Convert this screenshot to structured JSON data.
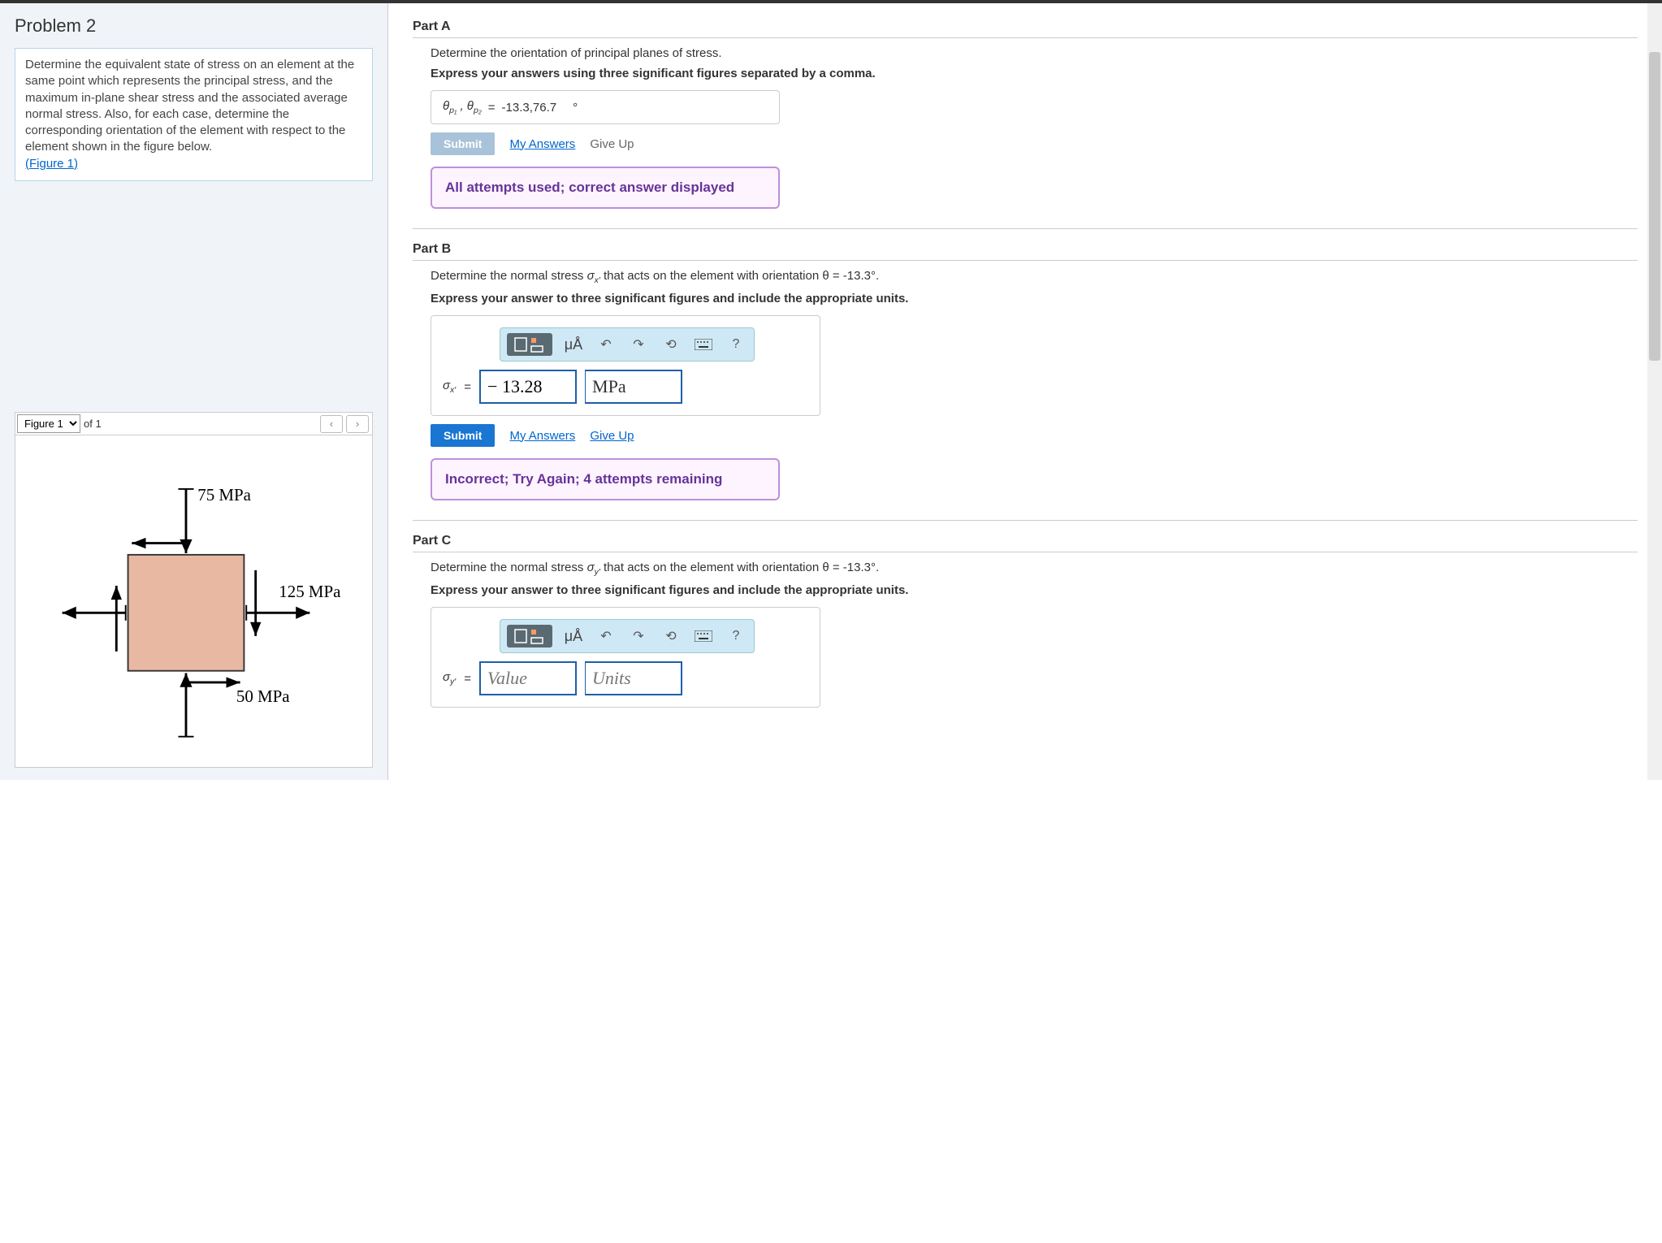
{
  "left": {
    "title": "Problem 2",
    "description": "Determine the equivalent state of stress on an element at the same point which represents the principal stress, and the maximum in-plane shear stress and the associated average normal stress. Also, for each case, determine the corresponding orientation of the element with respect to the element shown in the figure below.",
    "figure_link": "(Figure 1)",
    "figure_selector": "Figure 1",
    "figure_of": "of 1",
    "labels": {
      "top": "75 MPa",
      "right": "125 MPa",
      "bottom": "50 MPa"
    }
  },
  "partA": {
    "title": "Part A",
    "prompt": "Determine the orientation of principal planes of stress.",
    "instruction": "Express your answers using three significant figures separated by a comma.",
    "var_label": "θp₁ , θp₂",
    "equals": "=",
    "value": "-13.3,76.7",
    "unit": "°",
    "submit_label": "Submit",
    "my_answers": "My Answers",
    "give_up": "Give Up",
    "feedback": "All attempts used; correct answer displayed"
  },
  "partB": {
    "title": "Part B",
    "prompt_pre": "Determine the normal stress ",
    "prompt_var": "σx′",
    "prompt_post": " that acts on the element with orientation θ = -13.3°.",
    "instruction": "Express your answer to three significant figures and include the appropriate units.",
    "toolbar": {
      "mu": "μÅ",
      "help": "?"
    },
    "var_label": "σx′",
    "equals": "=",
    "value": "− 13.28",
    "unit": "MPa",
    "submit_label": "Submit",
    "my_answers": "My Answers",
    "give_up": "Give Up",
    "feedback": "Incorrect; Try Again; 4 attempts remaining"
  },
  "partC": {
    "title": "Part C",
    "prompt_pre": "Determine the normal stress ",
    "prompt_var": "σy′",
    "prompt_post": " that acts on the element with orientation θ = -13.3°.",
    "instruction": "Express your answer to three significant figures and include the appropriate units.",
    "toolbar": {
      "mu": "μÅ",
      "help": "?"
    },
    "var_label": "σy′",
    "equals": "=",
    "value_placeholder": "Value",
    "unit_placeholder": "Units"
  }
}
